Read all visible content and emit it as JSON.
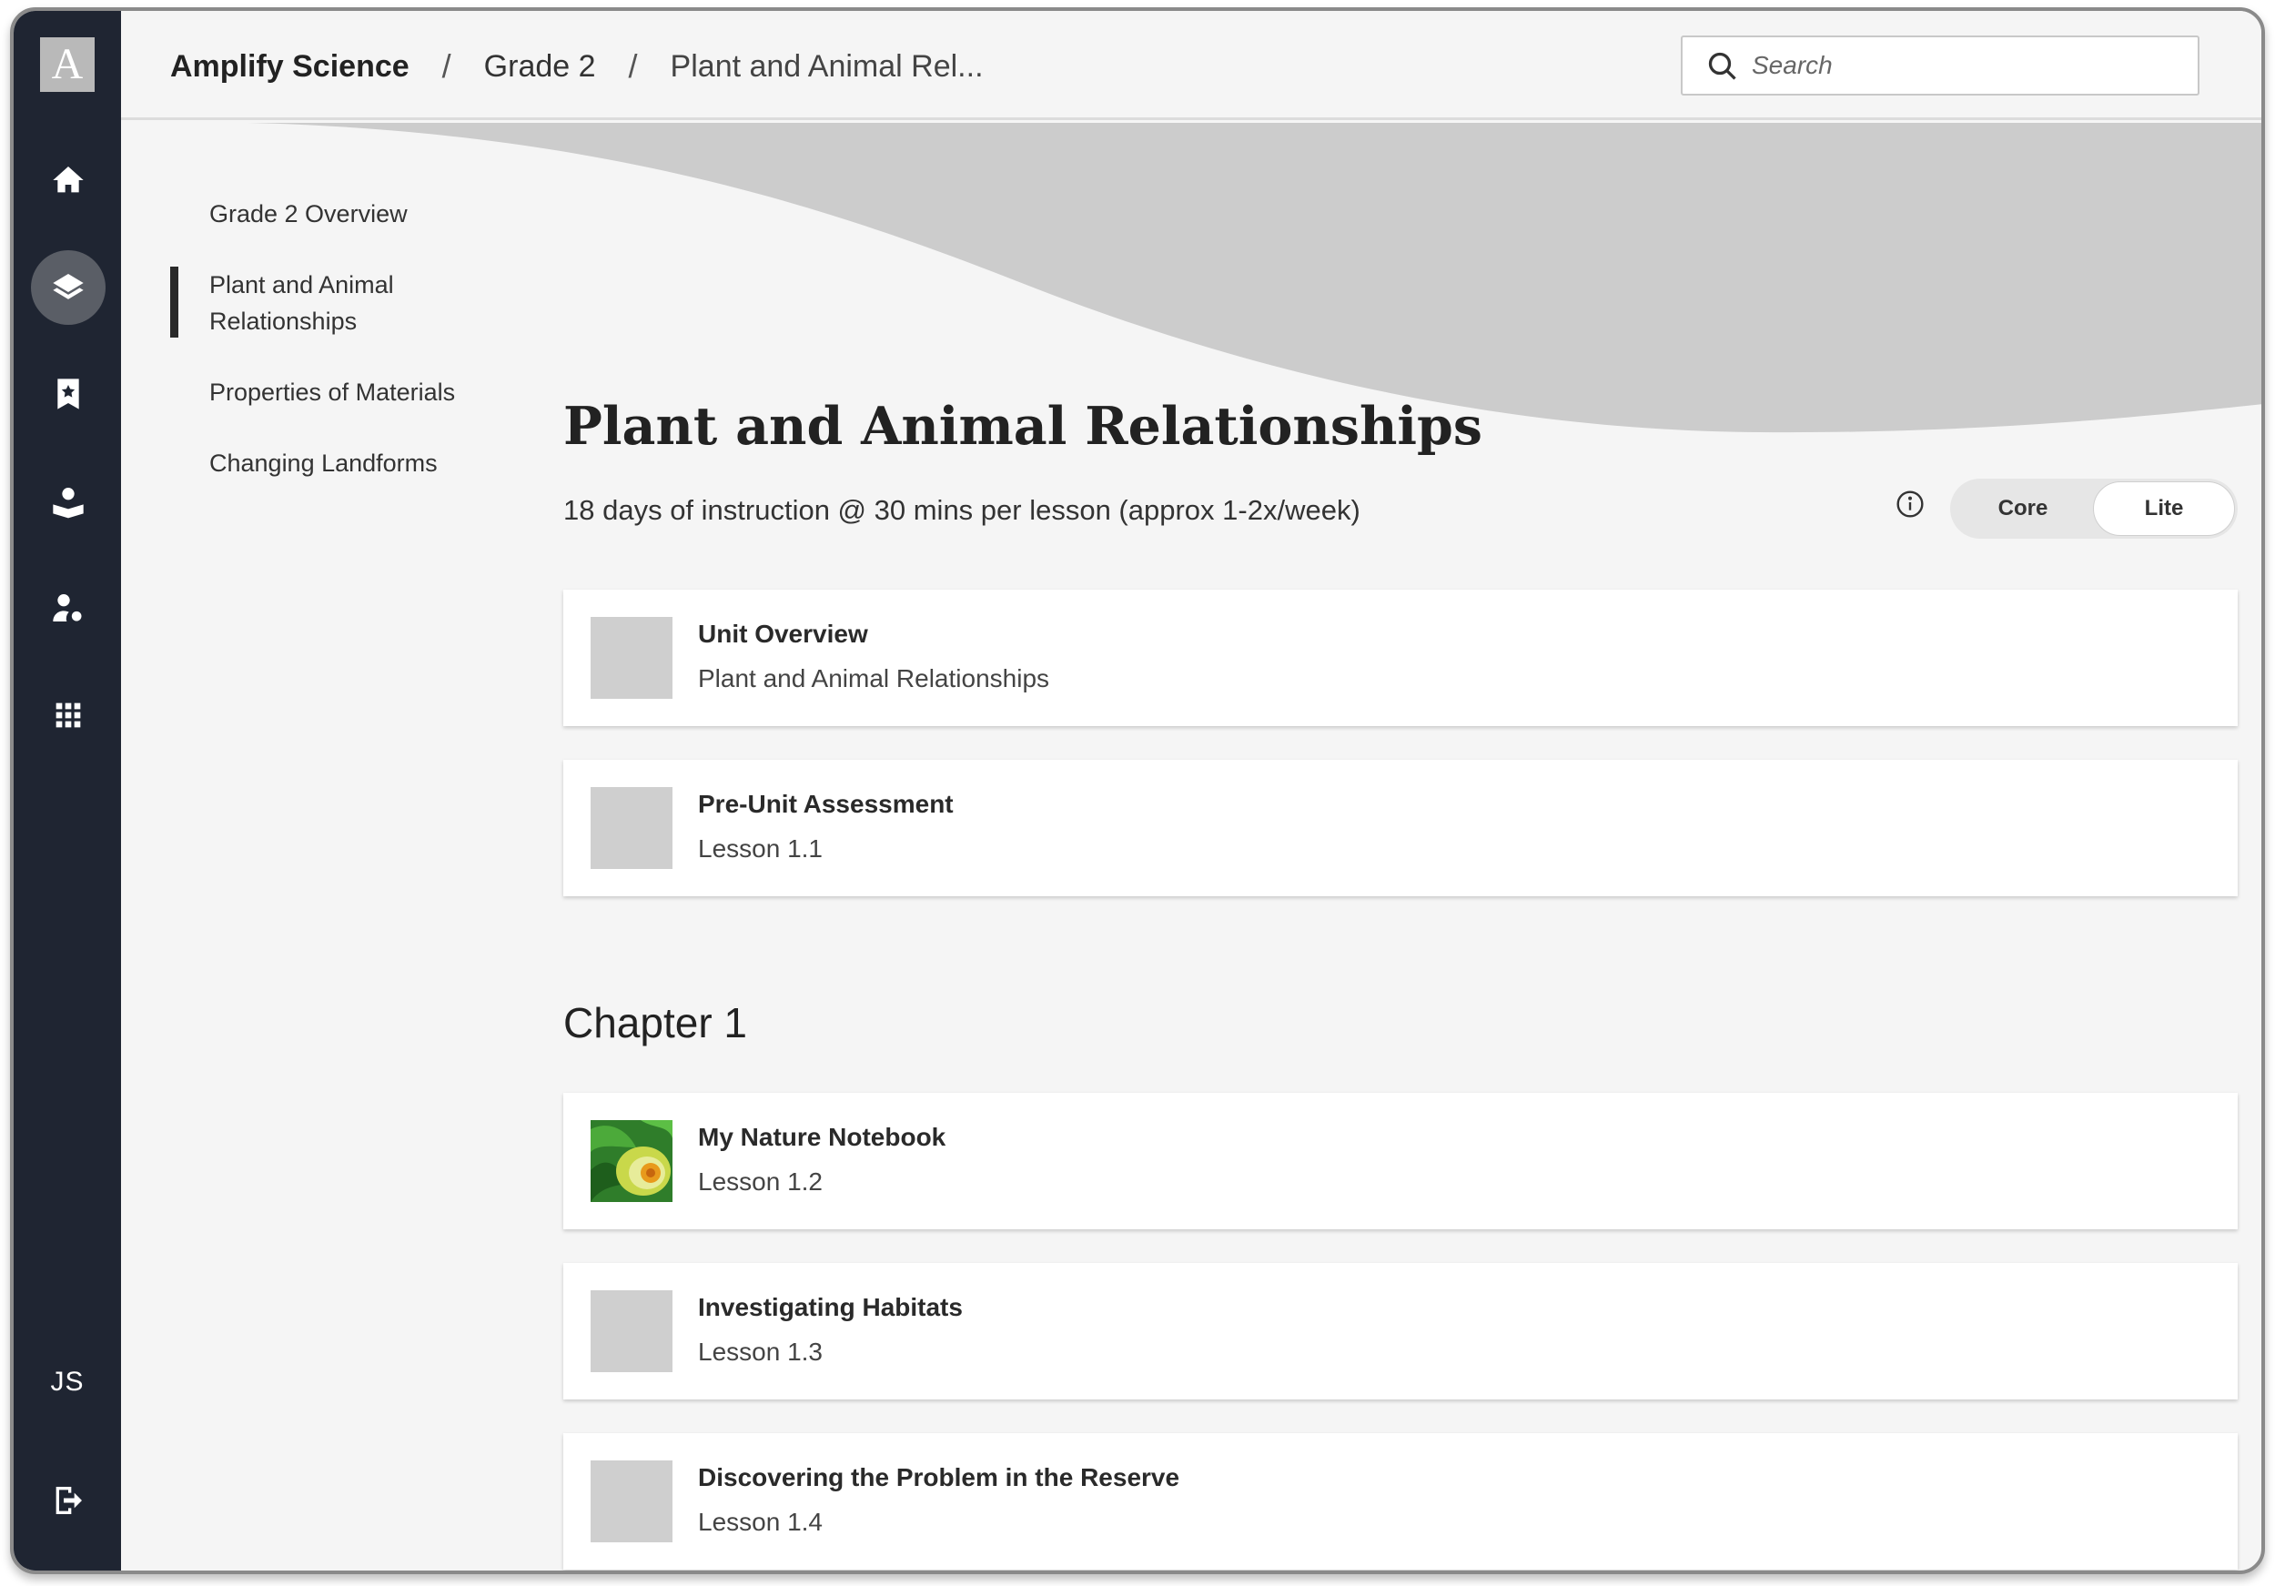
{
  "rail": {
    "logo_letter": "A",
    "user_initials": "JS",
    "items": [
      {
        "icon": "home-icon"
      },
      {
        "icon": "layers-icon",
        "active": true
      },
      {
        "icon": "bookmark-star-icon"
      },
      {
        "icon": "teacher-book-icon"
      },
      {
        "icon": "user-settings-icon"
      },
      {
        "icon": "grid-apps-icon"
      }
    ],
    "logout_icon": "logout-icon"
  },
  "header": {
    "breadcrumb": [
      "Amplify Science",
      "Grade 2",
      "Plant and Animal Rel..."
    ],
    "separator": "/",
    "search_placeholder": "Search"
  },
  "unit_nav": {
    "items": [
      {
        "label": "Grade 2 Overview",
        "active": false
      },
      {
        "label": "Plant and Animal Relationships",
        "active": true
      },
      {
        "label": "Properties of Materials",
        "active": false
      },
      {
        "label": "Changing Landforms",
        "active": false
      }
    ]
  },
  "unit": {
    "title": "Plant and Animal Relationships",
    "subtitle": "18 days of instruction @ 30 mins per lesson (approx 1-2x/week)",
    "toggle": {
      "options": [
        "Core",
        "Lite"
      ],
      "selected": "Lite"
    }
  },
  "intro_cards": [
    {
      "title": "Unit Overview",
      "subtitle": "Plant and Animal Relationships"
    },
    {
      "title": "Pre-Unit Assessment",
      "subtitle": "Lesson 1.1"
    }
  ],
  "chapter": {
    "heading": "Chapter 1",
    "cards": [
      {
        "title": "My Nature Notebook",
        "subtitle": "Lesson 1.2",
        "thumb": "leaf-image"
      },
      {
        "title": "Investigating Habitats",
        "subtitle": "Lesson 1.3"
      },
      {
        "title": "Discovering the Problem in the Reserve",
        "subtitle": "Lesson 1.4"
      }
    ]
  },
  "colors": {
    "rail_bg": "#1f2532",
    "page_bg": "#f5f5f5",
    "wave": "#cccccc",
    "placeholder_thumb": "#cfcfcf"
  }
}
